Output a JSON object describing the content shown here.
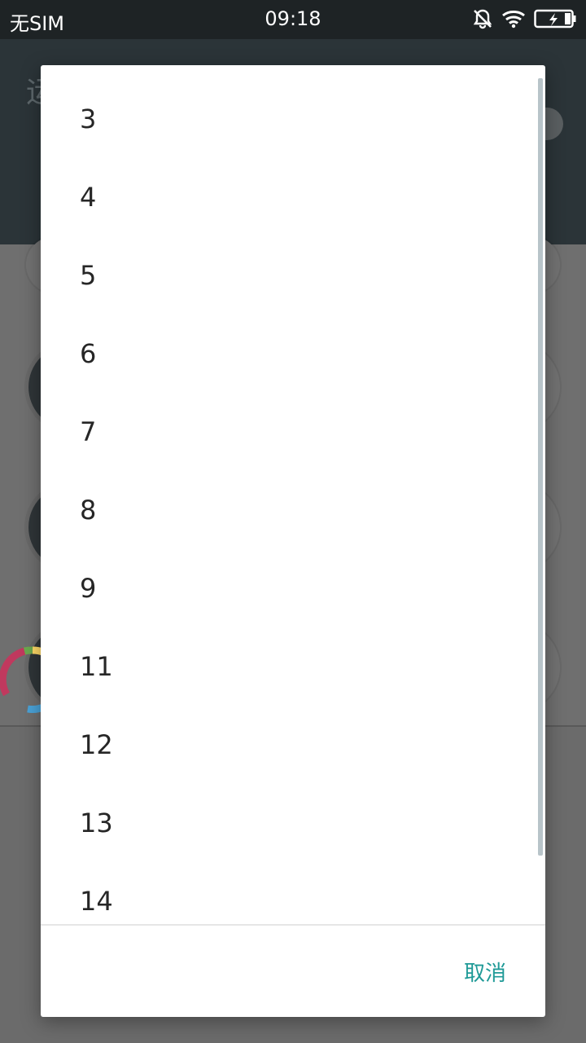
{
  "statusbar": {
    "carrier": "无SIM",
    "time": "09:18"
  },
  "app": {
    "title_partial": "运"
  },
  "dialog": {
    "items": [
      "3",
      "4",
      "5",
      "6",
      "7",
      "8",
      "9",
      "11",
      "12",
      "13",
      "14"
    ],
    "cancel_label": "取消"
  },
  "colors": {
    "accent": "#1f9a97",
    "scrollbar": "#b8c4c9",
    "loader_red": "#c0395e",
    "loader_green": "#6aa84f",
    "loader_yellow": "#ffd966",
    "loader_blue": "#4aa3d8"
  },
  "icons": {
    "status": [
      "bell-muted-icon",
      "wifi-icon",
      "battery-charging-icon"
    ]
  }
}
